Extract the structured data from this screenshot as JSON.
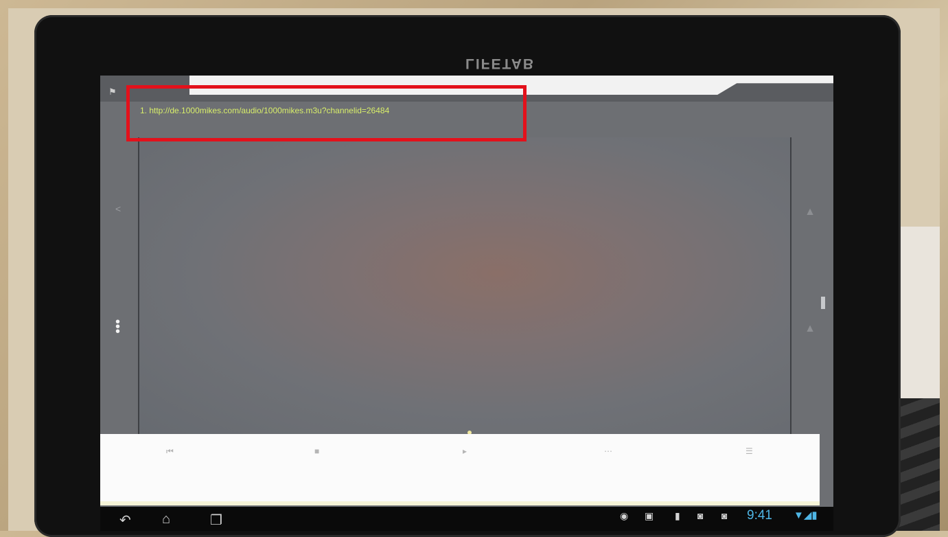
{
  "device": {
    "brand": "LIFETAB"
  },
  "playlist": {
    "url_line": "1. http://de.1000mikes.com/audio/1000mikes.m3u?channelid=26484"
  },
  "status_bar": {
    "time": "9:41"
  },
  "icons": {
    "flag": "flag-icon",
    "share": "share-icon",
    "menu": "menu-dots-icon",
    "back": "back-icon",
    "home": "home-icon",
    "recents": "recents-icon",
    "wifi": "wifi-icon",
    "battery": "battery-icon"
  },
  "colors": {
    "highlight": "#e3111b",
    "url_text": "#d8ee6a",
    "clock": "#4fb6e6"
  }
}
